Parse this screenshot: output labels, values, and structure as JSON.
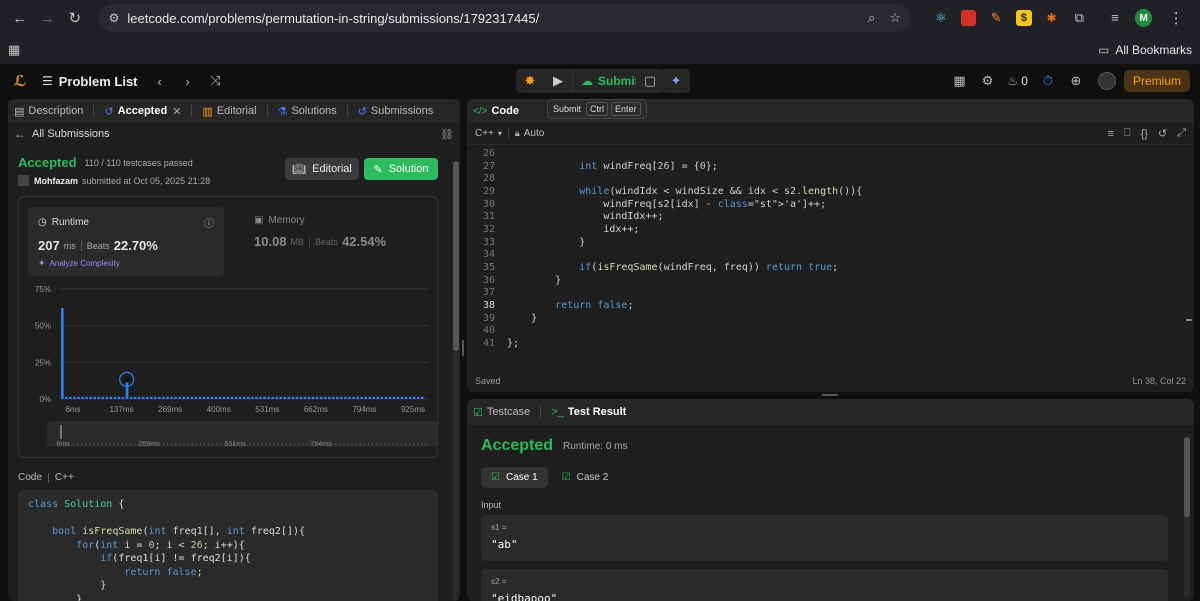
{
  "browser": {
    "url": "leetcode.com/problems/permutation-in-string/submissions/1792317445/",
    "all_bookmarks": "All Bookmarks",
    "profile_initial": "M"
  },
  "nav": {
    "problem_list": "Problem List",
    "submit": "Submit",
    "streak": "0",
    "premium": "Premium",
    "tooltip": {
      "label": "Submit",
      "k1": "Ctrl",
      "k2": "Enter"
    }
  },
  "left": {
    "tabs": {
      "description": "Description",
      "accepted": "Accepted",
      "editorial": "Editorial",
      "solutions": "Solutions",
      "submissions": "Submissions"
    },
    "all_submissions": "All Submissions",
    "status": "Accepted",
    "testcases": "110 / 110 testcases passed",
    "user": "Mohfazam",
    "submitted": "submitted at Oct 05, 2025 21:28",
    "btn_editorial": "Editorial",
    "btn_solution": "Solution",
    "runtime": {
      "label": "Runtime",
      "value": "207",
      "unit": "ms",
      "beats_label": "Beats",
      "beats": "22.70%",
      "analyze": "Analyze Complexity"
    },
    "memory": {
      "label": "Memory",
      "value": "10.08",
      "unit": "MB",
      "beats_label": "Beats",
      "beats": "42.54%"
    },
    "code_tab": "Code",
    "lang_tab": "C++",
    "code_lines": [
      "class Solution {",
      "",
      "    bool isFreqSame(int freq1[], int freq2[]){",
      "        for(int i = 0; i < 26; i++){",
      "            if(freq1[i] != freq2[i]){",
      "                return false;",
      "            }",
      "        }"
    ]
  },
  "chart_data": {
    "type": "bar",
    "y_ticks": [
      "75%",
      "50%",
      "25%",
      "0%"
    ],
    "ylim": [
      0,
      75
    ],
    "x_ticks": [
      "6ms",
      "137ms",
      "269ms",
      "400ms",
      "531ms",
      "662ms",
      "794ms",
      "925ms"
    ],
    "range_ticks": [
      "6ms",
      "269ms",
      "531ms",
      "794ms"
    ],
    "values": [
      62,
      1.5,
      1.5,
      1.5,
      1.5,
      1.5,
      1.5,
      1.5,
      1.5,
      1.5,
      1.5,
      1.5,
      1.5,
      1.5,
      1.5,
      1.5,
      12,
      1.5,
      1.5,
      1.5,
      1.5,
      1.5,
      1.5,
      1.5,
      1.5,
      1.5,
      1.5,
      1.5,
      1.5,
      1.5,
      1.5,
      1.5,
      1.5,
      1.5,
      1.5,
      1.5,
      1.5,
      1.5,
      1.5,
      1.5,
      1.5,
      1.5,
      1.5,
      1.5,
      1.5,
      1.5,
      1.5,
      1.5,
      1.5,
      1.5,
      1.5,
      1.5,
      1.5,
      1.5,
      1.5,
      1.5,
      1.5,
      1.5,
      1.5,
      1.5,
      1.5,
      1.5,
      1.5,
      1.5,
      1.5,
      1.5,
      1.5,
      1.5,
      1.5,
      1.5,
      1.5,
      1.5,
      1.5,
      1.5,
      1.5,
      1.5,
      1.5,
      1.5,
      1.5,
      1.5,
      1.5,
      1.5,
      1.5,
      1.5,
      1.5,
      1.5,
      1.5,
      1.5,
      1.5,
      1.5
    ],
    "highlight_index": 16,
    "bar_color": "#2f7ff0"
  },
  "editor": {
    "title": "Code",
    "lang": "C++",
    "mode": "Auto",
    "status": "Saved",
    "cursor": "Ln 38, Col 22",
    "lines": [
      {
        "n": "26",
        "t": ""
      },
      {
        "n": "27",
        "t": "            int windFreq[26] = {0};"
      },
      {
        "n": "28",
        "t": ""
      },
      {
        "n": "29",
        "t": "            while(windIdx < windSize && idx < s2.length()){"
      },
      {
        "n": "30",
        "t": "                windFreq[s2[idx] - 'a']++;"
      },
      {
        "n": "31",
        "t": "                windIdx++;"
      },
      {
        "n": "32",
        "t": "                idx++;"
      },
      {
        "n": "33",
        "t": "            }"
      },
      {
        "n": "34",
        "t": ""
      },
      {
        "n": "35",
        "t": "            if(isFreqSame(windFreq, freq)) return true;"
      },
      {
        "n": "36",
        "t": "        }"
      },
      {
        "n": "37",
        "t": ""
      },
      {
        "n": "38",
        "t": "        return false;"
      },
      {
        "n": "39",
        "t": "    }"
      },
      {
        "n": "40",
        "t": ""
      },
      {
        "n": "41",
        "t": "};"
      }
    ]
  },
  "result": {
    "tab_testcase": "Testcase",
    "tab_result": "Test Result",
    "status": "Accepted",
    "runtime": "Runtime: 0 ms",
    "case1": "Case 1",
    "case2": "Case 2",
    "input_label": "Input",
    "s1_label": "s1 =",
    "s1_value": "\"ab\"",
    "s2_label": "s2 =",
    "s2_value": "\"eidbaooo\""
  },
  "colors": {
    "accent_green": "#2cbb5d",
    "premium": "#ffa116",
    "bar": "#2f7ff0"
  }
}
